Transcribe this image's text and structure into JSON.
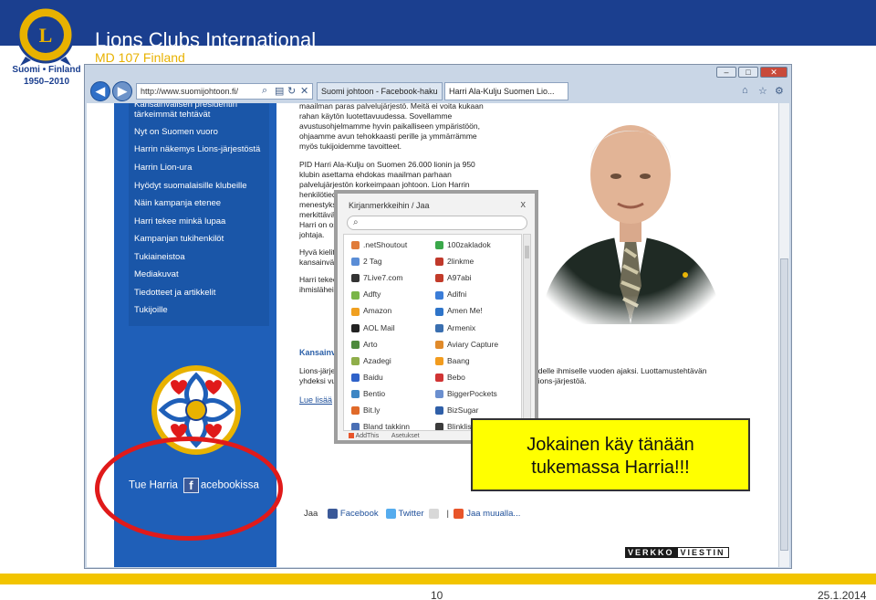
{
  "header": {
    "title": "Lions Clubs International",
    "subtitle": "MD 107 Finland",
    "logo_caption": [
      "Suomi • Finland",
      "1950–2010"
    ]
  },
  "browser": {
    "address": "http://www.suomijohtoon.fi/",
    "tabs": [
      "Suomi johtoon - Facebook-haku",
      "Harri Ala-Kulju Suomen Lio..."
    ],
    "window_buttons": [
      "–",
      "□",
      "✕"
    ]
  },
  "page": {
    "menu": [
      "Kansainvälisen presidentin tärkeimmät tehtävät",
      "Nyt on Suomen vuoro",
      "Harrin näkemys Lions-järjestöstä",
      "Harrin Lion-ura",
      "Hyödyt suomalaisille klubeille",
      "Näin kampanja etenee",
      "Harri tekee minkä lupaa",
      "Kampanjan tukihenkilöt",
      "Tukiaineistoa",
      "Mediakuvat",
      "Tiedotteet ja artikkelit",
      "Tukijoille"
    ],
    "body_lines_top": [
      "maailman paras palvelujärjestö. Meitä ei voita kukaan",
      "rahan käytön luotettavuudessa. Sovellamme",
      "avustusohjelmamme hyvin paikalliseen ympäristöön,",
      "ohjaamme avun tehokkaasti perille ja ymmärrämme",
      "myös tukijoidemme tavoitteet."
    ],
    "body_lines_mid": [
      "PID Harri Ala-Kulju on Suomen 26.000 lionin ja 950",
      "klubin asettama ehdokas maailman parhaan",
      "palvelujärjestön korkeimpaan johtoon. Lion Harrin",
      "henkilötiedot kertovat hyvästä peruskoulutuksesta,",
      "menestyksi",
      "merkittävä",
      "Harri on os",
      "johtaja."
    ],
    "body_lines_low": [
      "Hyvä kielita",
      "kansainväli"
    ],
    "body_lines_low2": [
      "Harri tekee",
      "ihmislähein"
    ],
    "section_heading": "Kansainva",
    "section_lines": [
      "Lions-järjes",
      "yhdeksi vuo"
    ],
    "section_lines_right": [
      "hdelle ihmiselle vuoden ajaksi. Luottamustehtävän",
      "Lions-järjestöä."
    ],
    "read_more": "Lue lisää",
    "facebook_link": {
      "before": "Tue Harria",
      "after": "acebookissa",
      "icon_letter": "f"
    },
    "share": {
      "label": "Jaa",
      "facebook": "Facebook",
      "twitter": "Twitter",
      "separator": "|",
      "more": "Jaa muualla..."
    },
    "sponsor": {
      "part1": "VERKKO",
      "part2": "VIESTIN"
    }
  },
  "popup": {
    "title": "Kirjanmerkkeihin / Jaa",
    "close": "x",
    "services_left": [
      {
        "label": ".netShoutout",
        "color": "#e07b39"
      },
      {
        "label": "2 Tag",
        "color": "#5a8dd6"
      },
      {
        "label": "7Live7.com",
        "color": "#333333"
      },
      {
        "label": "Adfty",
        "color": "#7ab648"
      },
      {
        "label": "Amazon",
        "color": "#f0a020"
      },
      {
        "label": "AOL Mail",
        "color": "#222222"
      },
      {
        "label": "Arto",
        "color": "#4d8a3c"
      },
      {
        "label": "Azadegi",
        "color": "#8fae4a"
      },
      {
        "label": "Baidu",
        "color": "#2f62c9"
      },
      {
        "label": "Bentio",
        "color": "#3c86c4"
      },
      {
        "label": "Bit.ly",
        "color": "#e06a2a"
      },
      {
        "label": "Bland takkinn",
        "color": "#4a6fb5"
      }
    ],
    "services_right": [
      {
        "label": "100zakladok",
        "color": "#3aa84a"
      },
      {
        "label": "2linkme",
        "color": "#c0392b"
      },
      {
        "label": "A97abi",
        "color": "#c23b2a"
      },
      {
        "label": "Adifni",
        "color": "#3b7dd8"
      },
      {
        "label": "Amen Me!",
        "color": "#2e74c9"
      },
      {
        "label": "Armenix",
        "color": "#3a6fb0"
      },
      {
        "label": "Aviary Capture",
        "color": "#e08a2a"
      },
      {
        "label": "Baang",
        "color": "#f29c1f"
      },
      {
        "label": "Bebo",
        "color": "#d03434"
      },
      {
        "label": "BiggerPockets",
        "color": "#6b8fcf"
      },
      {
        "label": "BizSugar",
        "color": "#2f5fa8"
      },
      {
        "label": "Blinklist",
        "color": "#3b3b3b"
      }
    ],
    "footer": [
      "AddThis",
      "Asetukset"
    ]
  },
  "callout": {
    "line1": "Jokainen käy tänään",
    "line2": "tukemassa Harria!!!"
  },
  "footer": {
    "page_number": "10",
    "date": "25.1.2014"
  },
  "colors": {
    "brand_blue": "#1b3f8f",
    "brand_gold": "#f2c400",
    "highlight_red": "#e01a1a",
    "callout_yellow": "#ffff00"
  }
}
